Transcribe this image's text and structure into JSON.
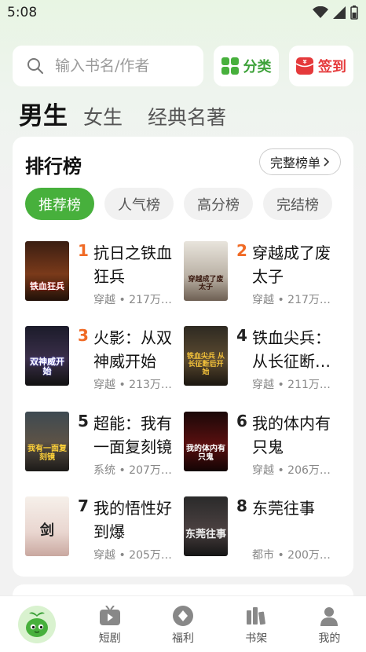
{
  "status_bar": {
    "time": "5:08"
  },
  "search": {
    "placeholder": "输入书名/作者"
  },
  "buttons": {
    "category": "分类",
    "checkin": "签到"
  },
  "gender_tabs": [
    "男生",
    "女生",
    "经典名著"
  ],
  "ranking": {
    "title": "排行榜",
    "full_list_label": "完整榜单",
    "tabs": [
      "推荐榜",
      "人气榜",
      "高分榜",
      "完结榜"
    ],
    "books": [
      {
        "rank": "1",
        "title": "抗日之铁血狂兵",
        "meta": "穿越 • 217万…",
        "cover_text": "铁血狂兵"
      },
      {
        "rank": "2",
        "title": "穿越成了废太子",
        "meta": "穿越 • 217万…",
        "cover_text": "穿越成了废太子"
      },
      {
        "rank": "3",
        "title": "火影：从双神威开始",
        "meta": "穿越 • 213万…",
        "cover_text": "双神威开始"
      },
      {
        "rank": "4",
        "title": "铁血尖兵：从长征断…",
        "meta": "穿越 • 211万…",
        "cover_text": "铁血尖兵 从长征断后开始"
      },
      {
        "rank": "5",
        "title": "超能：我有一面复刻镜",
        "meta": "系统 • 207万…",
        "cover_text": "我有一面复刻镜"
      },
      {
        "rank": "6",
        "title": "我的体内有只鬼",
        "meta": "穿越 • 206万…",
        "cover_text": "我的体内有只鬼"
      },
      {
        "rank": "7",
        "title": "我的悟性好到爆",
        "meta": "穿越 • 205万…",
        "cover_text": "剑"
      },
      {
        "rank": "8",
        "title": "东莞往事",
        "meta": "都市 • 200万…",
        "cover_text": "东莞往事"
      }
    ]
  },
  "bottom_nav": {
    "items": [
      {
        "label": "短剧"
      },
      {
        "label": "福利"
      },
      {
        "label": "书架"
      },
      {
        "label": "我的"
      }
    ]
  },
  "colors": {
    "accent": "#47b03c",
    "rank_highlight": "#f06a25",
    "checkin": "#e5393b"
  }
}
